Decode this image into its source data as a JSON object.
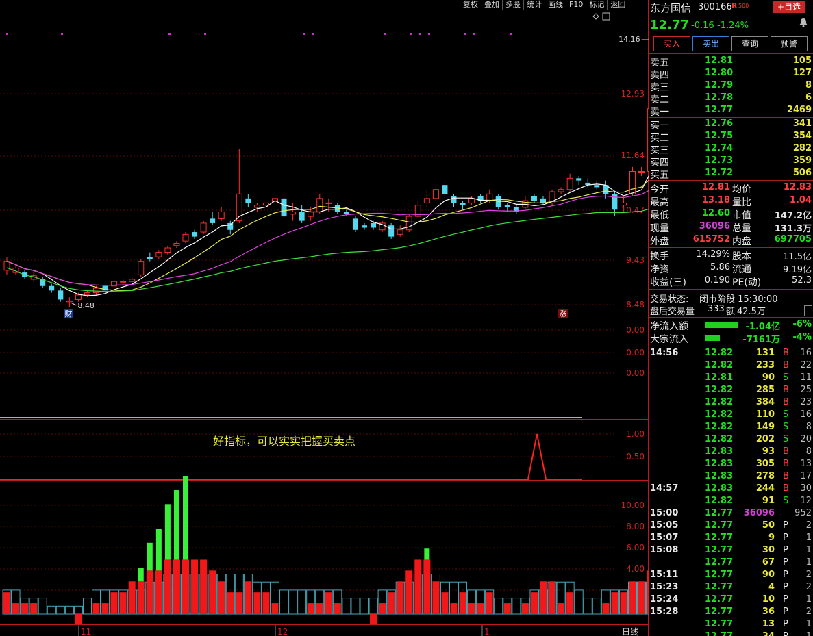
{
  "toolbar": [
    "复权",
    "叠加",
    "多股",
    "统计",
    "画线",
    "F10",
    "标记",
    "返回"
  ],
  "stock": {
    "name": "东方国信",
    "code": "300166",
    "r_mark": "R",
    "r_val": "500",
    "add_btn": "+自选",
    "price": "12.77",
    "change": "-0.16",
    "pct": "-1.24%"
  },
  "trade_buttons": [
    "买入",
    "卖出",
    "查询",
    "预警"
  ],
  "asks": [
    {
      "label": "卖五",
      "price": "12.81",
      "vol": "105"
    },
    {
      "label": "卖四",
      "price": "12.80",
      "vol": "127"
    },
    {
      "label": "卖三",
      "price": "12.79",
      "vol": "8"
    },
    {
      "label": "卖二",
      "price": "12.78",
      "vol": "6"
    },
    {
      "label": "卖一",
      "price": "12.77",
      "vol": "2469"
    }
  ],
  "bids": [
    {
      "label": "买一",
      "price": "12.76",
      "vol": "341"
    },
    {
      "label": "买二",
      "price": "12.75",
      "vol": "354"
    },
    {
      "label": "买三",
      "price": "12.74",
      "vol": "282"
    },
    {
      "label": "买四",
      "price": "12.73",
      "vol": "359"
    },
    {
      "label": "买五",
      "price": "12.72",
      "vol": "506"
    }
  ],
  "stats": [
    {
      "l1": "今开",
      "v1": "12.81",
      "l2": "均价",
      "v2": "12.83",
      "c1": "red",
      "c2": "red"
    },
    {
      "l1": "最高",
      "v1": "13.18",
      "l2": "量比",
      "v2": "1.04",
      "c1": "red",
      "c2": "red"
    },
    {
      "l1": "最低",
      "v1": "12.60",
      "l2": "市值",
      "v2": "147.2亿",
      "c1": "green",
      "c2": "white"
    },
    {
      "l1": "现量",
      "v1": "36096",
      "l2": "总量",
      "v2": "131.3万",
      "c1": "purple",
      "c2": "white"
    },
    {
      "l1": "外盘",
      "v1": "615752",
      "l2": "内盘",
      "v2": "697705",
      "c1": "red",
      "c2": "green"
    }
  ],
  "stats2": [
    {
      "l1": "换手",
      "v1": "14.29%",
      "l2": "股本",
      "v2": "11.5亿"
    },
    {
      "l1": "净资",
      "v1": "5.86",
      "l2": "流通",
      "v2": "9.19亿"
    },
    {
      "l1": "收益(三)",
      "v1": "0.190",
      "l2": "PE(动)",
      "v2": "52.3"
    }
  ],
  "status": {
    "label": "交易状态:",
    "value": "闭市阶段 15:30:00",
    "after_label": "盘后交易量",
    "after_vol": "333",
    "after_amt_label": "额",
    "after_amt": "42.5万"
  },
  "flows": [
    {
      "label": "净流入额",
      "value": "-1.04亿",
      "pct": "-6%",
      "ratio": 0.6
    },
    {
      "label": "大宗流入",
      "value": "-7161万",
      "pct": "-4%",
      "ratio": 0.28
    }
  ],
  "ticks": [
    {
      "time": "14:56",
      "price": "12.82",
      "vol": "131",
      "bs": "B",
      "n": "16"
    },
    {
      "time": "",
      "price": "12.82",
      "vol": "233",
      "bs": "B",
      "n": "22"
    },
    {
      "time": "",
      "price": "12.81",
      "vol": "90",
      "bs": "S",
      "n": "11"
    },
    {
      "time": "",
      "price": "12.82",
      "vol": "285",
      "bs": "B",
      "n": "25"
    },
    {
      "time": "",
      "price": "12.82",
      "vol": "384",
      "bs": "B",
      "n": "23"
    },
    {
      "time": "",
      "price": "12.82",
      "vol": "110",
      "bs": "S",
      "n": "16"
    },
    {
      "time": "",
      "price": "12.82",
      "vol": "149",
      "bs": "S",
      "n": "8"
    },
    {
      "time": "",
      "price": "12.82",
      "vol": "202",
      "bs": "S",
      "n": "20"
    },
    {
      "time": "",
      "price": "12.83",
      "vol": "93",
      "bs": "B",
      "n": "8"
    },
    {
      "time": "",
      "price": "12.83",
      "vol": "305",
      "bs": "B",
      "n": "13"
    },
    {
      "time": "",
      "price": "12.83",
      "vol": "278",
      "bs": "B",
      "n": "17"
    },
    {
      "time": "14:57",
      "price": "12.83",
      "vol": "244",
      "bs": "B",
      "n": "30"
    },
    {
      "time": "",
      "price": "12.82",
      "vol": "91",
      "bs": "S",
      "n": "12"
    },
    {
      "time": "15:00",
      "price": "12.77",
      "vol": "36096",
      "bs": "",
      "n": "952"
    },
    {
      "time": "15:05",
      "price": "12.77",
      "vol": "50",
      "bs": "P",
      "n": "2"
    },
    {
      "time": "15:07",
      "price": "12.77",
      "vol": "9",
      "bs": "P",
      "n": "1"
    },
    {
      "time": "15:08",
      "price": "12.77",
      "vol": "30",
      "bs": "P",
      "n": "1"
    },
    {
      "time": "",
      "price": "12.77",
      "vol": "67",
      "bs": "P",
      "n": "1"
    },
    {
      "time": "15:11",
      "price": "12.77",
      "vol": "90",
      "bs": "P",
      "n": "2"
    },
    {
      "time": "15:23",
      "price": "12.77",
      "vol": "4",
      "bs": "P",
      "n": "2"
    },
    {
      "time": "15:24",
      "price": "12.77",
      "vol": "10",
      "bs": "P",
      "n": "1"
    },
    {
      "time": "15:28",
      "price": "12.77",
      "vol": "36",
      "bs": "P",
      "n": "2"
    },
    {
      "time": "",
      "price": "12.77",
      "vol": "13",
      "bs": "P",
      "n": "1"
    },
    {
      "time": "",
      "price": "12.77",
      "vol": "34",
      "bs": "P",
      "n": "1"
    }
  ],
  "chart": {
    "price_axis": [
      "12.93",
      "11.64",
      "10.47",
      "9.43",
      "8.48"
    ],
    "high_label": "14.16",
    "low_label": "8.48",
    "cai_mark": "财",
    "zhang_mark": "涨",
    "ind1_axis": [
      "0.00",
      "0.00",
      "0.00"
    ],
    "ind2_axis": [
      "1.00",
      "0.50"
    ],
    "ind2_text": "好指标，可以实实把握买卖点",
    "ind3_axis": [
      "10.00",
      "8.00",
      "6.00",
      "4.00",
      "2.00"
    ],
    "months": [
      "11",
      "12",
      "1"
    ],
    "period": "日线"
  },
  "chart_data": {
    "type": "candlestick",
    "candles": [
      [
        9.3,
        9.5,
        9.6,
        9.2
      ],
      [
        9.25,
        9.35,
        9.45,
        9.2
      ],
      [
        9.25,
        9.15,
        9.3,
        9.1
      ],
      [
        9.1,
        9.18,
        9.25,
        9.05
      ],
      [
        9.1,
        8.95,
        9.15,
        8.9
      ],
      [
        8.95,
        8.85,
        9.0,
        8.8
      ],
      [
        8.85,
        8.65,
        8.9,
        8.6
      ],
      [
        8.6,
        8.62,
        8.7,
        8.48
      ],
      [
        8.65,
        8.75,
        8.8,
        8.6
      ],
      [
        8.75,
        8.8,
        8.85,
        8.7
      ],
      [
        8.8,
        8.9,
        8.95,
        8.75
      ],
      [
        8.95,
        8.85,
        9.0,
        8.8
      ],
      [
        8.95,
        9.05,
        9.1,
        8.9
      ],
      [
        9.05,
        9.05,
        9.1,
        9.0
      ],
      [
        9.05,
        9.1,
        9.15,
        9.0
      ],
      [
        9.2,
        9.5,
        9.55,
        9.15
      ],
      [
        9.6,
        9.55,
        9.7,
        9.5
      ],
      [
        9.6,
        9.7,
        9.75,
        9.55
      ],
      [
        9.7,
        9.8,
        9.85,
        9.65
      ],
      [
        9.85,
        9.9,
        9.95,
        9.8
      ],
      [
        9.95,
        10.1,
        10.15,
        9.9
      ],
      [
        10.15,
        10.05,
        10.2,
        10.0
      ],
      [
        10.15,
        10.35,
        10.4,
        10.1
      ],
      [
        10.45,
        10.35,
        10.6,
        10.3
      ],
      [
        10.45,
        10.6,
        10.7,
        10.4
      ],
      [
        10.35,
        10.2,
        10.4,
        10.1
      ],
      [
        10.4,
        11.0,
        12.0,
        10.35
      ],
      [
        10.9,
        10.8,
        11.0,
        10.7
      ],
      [
        10.7,
        10.75,
        10.8,
        10.6
      ],
      [
        10.75,
        10.8,
        10.85,
        10.7
      ],
      [
        10.8,
        10.9,
        10.95,
        10.75
      ],
      [
        10.9,
        10.5,
        11.0,
        10.45
      ],
      [
        10.55,
        10.6,
        10.8,
        10.4
      ],
      [
        10.6,
        10.4,
        10.75,
        10.35
      ],
      [
        10.5,
        10.6,
        10.7,
        10.4
      ],
      [
        10.6,
        10.9,
        11.0,
        10.55
      ],
      [
        10.8,
        10.8,
        10.9,
        10.6
      ],
      [
        10.75,
        10.6,
        10.8,
        10.55
      ],
      [
        10.6,
        10.55,
        10.65,
        10.5
      ],
      [
        10.45,
        10.2,
        10.5,
        10.15
      ],
      [
        10.3,
        10.25,
        10.35,
        10.2
      ],
      [
        10.35,
        10.25,
        10.4,
        10.2
      ],
      [
        10.2,
        10.35,
        10.4,
        10.15
      ],
      [
        10.3,
        10.05,
        10.35,
        10.0
      ],
      [
        10.1,
        10.2,
        10.3,
        10.05
      ],
      [
        10.2,
        10.5,
        10.55,
        10.15
      ],
      [
        10.5,
        10.75,
        10.85,
        10.45
      ],
      [
        10.8,
        10.9,
        11.1,
        10.7
      ],
      [
        10.9,
        11.1,
        11.2,
        10.85
      ],
      [
        11.2,
        11.0,
        11.3,
        10.9
      ],
      [
        10.95,
        10.8,
        11.0,
        10.7
      ],
      [
        10.8,
        10.75,
        10.85,
        10.65
      ],
      [
        10.8,
        10.9,
        10.95,
        10.75
      ],
      [
        10.95,
        10.85,
        11.0,
        10.8
      ],
      [
        10.85,
        11.0,
        11.1,
        10.8
      ],
      [
        10.95,
        10.7,
        11.0,
        10.65
      ],
      [
        10.75,
        10.7,
        10.8,
        10.6
      ],
      [
        10.7,
        10.6,
        10.75,
        10.55
      ],
      [
        10.7,
        10.85,
        10.95,
        10.65
      ],
      [
        10.95,
        10.85,
        11.0,
        10.8
      ],
      [
        10.9,
        10.8,
        10.95,
        10.75
      ],
      [
        10.8,
        11.05,
        11.1,
        10.75
      ],
      [
        11.05,
        11.1,
        11.15,
        11.0
      ],
      [
        11.1,
        11.35,
        11.45,
        11.05
      ],
      [
        11.35,
        11.3,
        11.4,
        11.2
      ],
      [
        11.25,
        11.2,
        11.35,
        11.15
      ],
      [
        11.2,
        11.15,
        11.3,
        11.1
      ],
      [
        11.2,
        11.0,
        11.3,
        10.9
      ],
      [
        11.0,
        10.65,
        11.05,
        10.5
      ],
      [
        10.75,
        10.8,
        10.95,
        10.7
      ],
      [
        11.0,
        11.5,
        11.6,
        10.95
      ],
      [
        11.5,
        11.5,
        11.6,
        11.4
      ],
      [
        11.5,
        12.9,
        13.3,
        11.45
      ],
      [
        13.0,
        12.8,
        14.16,
        12.7
      ],
      [
        12.93,
        12.77,
        13.18,
        12.6
      ]
    ]
  }
}
